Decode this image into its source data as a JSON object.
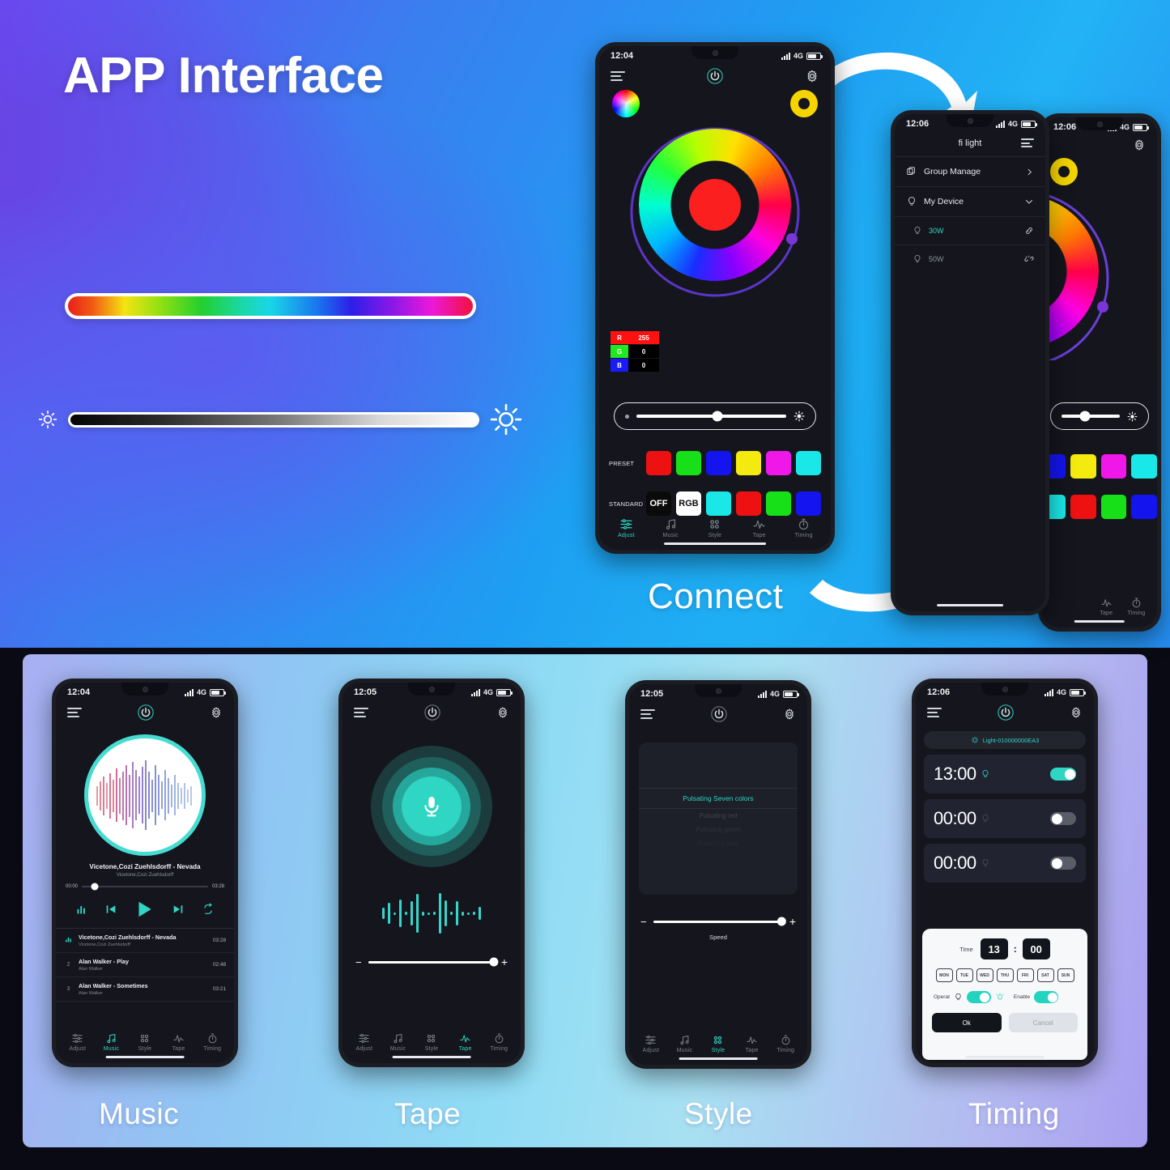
{
  "hero": {
    "title": "APP Interface",
    "connect_label": "Connect",
    "color_slider": {
      "name": "rainbow-color-slider"
    },
    "brightness_slider": {
      "name": "brightness-slider",
      "left_icon": "sun-small-icon",
      "right_icon": "sun-large-icon"
    }
  },
  "phone_main": {
    "status": {
      "time": "12:04",
      "network": "4G"
    },
    "icons": {
      "menu": "hamburger-icon",
      "power": "power-icon",
      "settings": "gear-icon",
      "wheel_swatch": "color-wheel-swatch",
      "yellow_swatch": "yellow-swatch"
    },
    "rgb": {
      "r_label": "R",
      "r_value": "255",
      "g_label": "G",
      "g_value": "0",
      "b_label": "B",
      "b_value": "0"
    },
    "preset_label": "PRESET",
    "preset_colors": [
      "#ee1111",
      "#18e018",
      "#1414ee",
      "#f5ea10",
      "#f018e8",
      "#1ae8e8"
    ],
    "standard_label": "STANDARD",
    "standard_items": [
      {
        "type": "text",
        "label": "OFF",
        "bg": "#0a0a0a",
        "fg": "#ffffff"
      },
      {
        "type": "text",
        "label": "RGB",
        "bg": "#ffffff",
        "fg": "#0a0a0a"
      },
      {
        "type": "color",
        "label": "",
        "bg": "#1ae8e8",
        "fg": ""
      },
      {
        "type": "color",
        "label": "",
        "bg": "#ee1111",
        "fg": ""
      },
      {
        "type": "color",
        "label": "",
        "bg": "#18e018",
        "fg": ""
      },
      {
        "type": "color",
        "label": "",
        "bg": "#1414ee",
        "fg": ""
      }
    ],
    "tabs": [
      {
        "label": "Adjust",
        "icon": "sliders-icon",
        "active": true
      },
      {
        "label": "Music",
        "icon": "music-note-icon",
        "active": false
      },
      {
        "label": "Style",
        "icon": "grid-dots-icon",
        "active": false
      },
      {
        "label": "Tape",
        "icon": "waveform-icon",
        "active": false
      },
      {
        "label": "Timing",
        "icon": "stopwatch-icon",
        "active": false
      }
    ]
  },
  "phone_list": {
    "status": {
      "time": "12:06",
      "network": "4G"
    },
    "title": "fi light",
    "icons": {
      "menu": "hamburger-icon",
      "settings": "gear-icon"
    },
    "rows": [
      {
        "label": "Group Manage",
        "icon": "group-icon",
        "trailing": "chevron-right-icon",
        "level": "top"
      },
      {
        "label": "My Device",
        "icon": "bulb-icon",
        "trailing": "chevron-down-icon",
        "level": "top"
      },
      {
        "label": "30W",
        "icon": "bulb-icon",
        "trailing": "link-icon",
        "level": "sub",
        "connected": true
      },
      {
        "label": "50W",
        "icon": "bulb-icon",
        "trailing": "broken-link-icon",
        "level": "sub",
        "connected": false
      }
    ]
  },
  "bottom": {
    "labels": [
      "Music",
      "Tape",
      "Style",
      "Timing"
    ],
    "music": {
      "status": {
        "time": "12:04",
        "network": "4G"
      },
      "now_playing": {
        "title": "Vicetone,Cozi Zuehlsdorff - Nevada",
        "artist": "Vicetone,Cozi Zuehlsdorff",
        "elapsed": "00:00",
        "duration": "03:28"
      },
      "controls": [
        "equalizer-icon",
        "previous-icon",
        "play-icon",
        "next-icon",
        "repeat-icon"
      ],
      "playlist": [
        {
          "index": "",
          "title": "Vicetone,Cozi Zuehlsdorff - Nevada",
          "artist": "Vicetone,Cozi Zuehlsdorff",
          "duration": "03:28",
          "playing": true
        },
        {
          "index": "2",
          "title": "Alan Walker - Play",
          "artist": "Alan Walker",
          "duration": "02:48",
          "playing": false
        },
        {
          "index": "3",
          "title": "Alan Walker - Sometimes",
          "artist": "Alan Walker",
          "duration": "03:21",
          "playing": false
        }
      ],
      "tabs": [
        {
          "label": "Adjust",
          "active": false
        },
        {
          "label": "Music",
          "active": true
        },
        {
          "label": "Style",
          "active": false
        },
        {
          "label": "Tape",
          "active": false
        },
        {
          "label": "Timing",
          "active": false
        }
      ]
    },
    "tape": {
      "status": {
        "time": "12:05",
        "network": "4G"
      },
      "mic_icon": "microphone-icon",
      "sensitivity_slider": {
        "minus": "−",
        "plus": "+"
      },
      "tabs": [
        {
          "label": "Adjust",
          "active": false
        },
        {
          "label": "Music",
          "active": false
        },
        {
          "label": "Style",
          "active": false
        },
        {
          "label": "Tape",
          "active": true
        },
        {
          "label": "Timing",
          "active": false
        }
      ]
    },
    "style": {
      "status": {
        "time": "12:05",
        "network": "4G"
      },
      "items": [
        {
          "label": "Pulsating Seven colors",
          "selected": true
        },
        {
          "label": "Pulsating red",
          "selected": false
        },
        {
          "label": "Pulsating green",
          "selected": false
        },
        {
          "label": "Pulsating blue",
          "selected": false
        }
      ],
      "speed_label": "Speed",
      "speed_slider": {
        "minus": "−",
        "plus": "+"
      },
      "tabs": [
        {
          "label": "Adjust",
          "active": false
        },
        {
          "label": "Music",
          "active": false
        },
        {
          "label": "Style",
          "active": true
        },
        {
          "label": "Tape",
          "active": false
        },
        {
          "label": "Timing",
          "active": false
        }
      ]
    },
    "timing": {
      "status": {
        "time": "12:06",
        "network": "4G"
      },
      "device_chip": "Light-010000000EA3",
      "alarms": [
        {
          "time": "13:00",
          "enabled": true
        },
        {
          "time": "00:00",
          "enabled": false
        },
        {
          "time": "00:00",
          "enabled": false
        }
      ],
      "picker": {
        "time_label": "Time",
        "hour": "13",
        "colon": ":",
        "minute": "00",
        "days": [
          "MON",
          "TUE",
          "WED",
          "THU",
          "FRI",
          "SAT",
          "SUN"
        ],
        "operat_label": "Operat",
        "enable_label": "Enable",
        "ok_label": "Ok",
        "cancel_label": "Cancel"
      }
    }
  },
  "colors": {
    "accent": "#2fd6c4",
    "red": "#fb1f1f",
    "yellow": "#f5d400",
    "phone_bg": "#15161d"
  }
}
